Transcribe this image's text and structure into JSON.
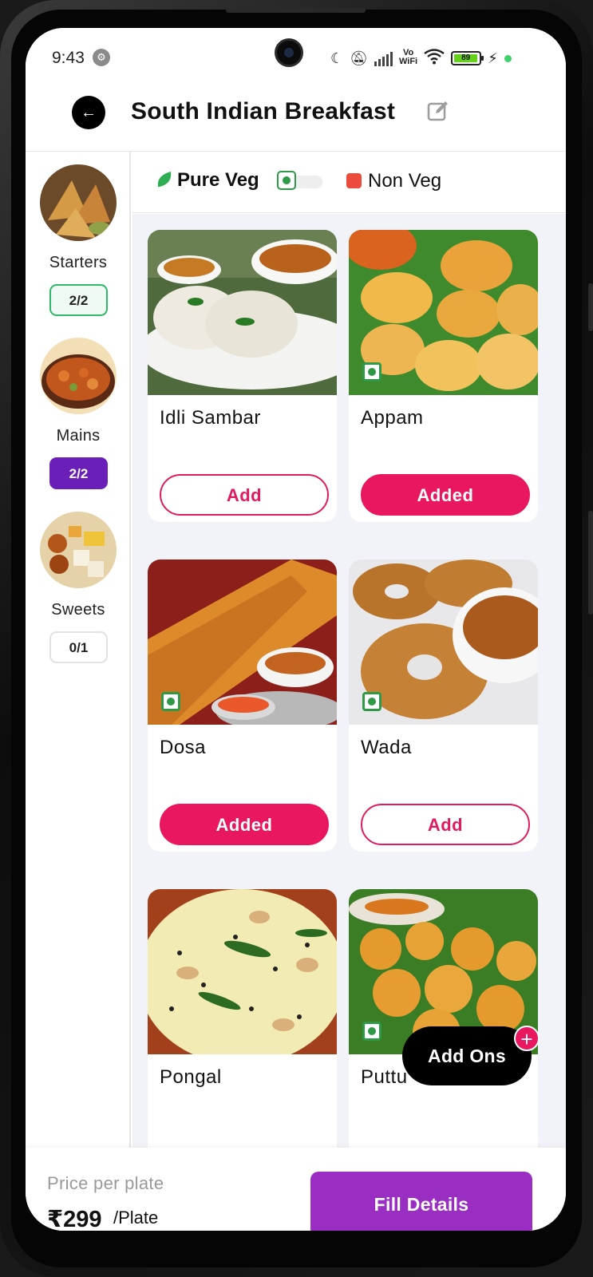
{
  "status_bar": {
    "time": "9:43",
    "vowifi_line1": "Vo",
    "vowifi_line2": "WiFi",
    "battery": "89"
  },
  "header": {
    "title": "South Indian Breakfast"
  },
  "sidebar": {
    "categories": [
      {
        "label": "Starters",
        "count": "2/2"
      },
      {
        "label": "Mains",
        "count": "2/2"
      },
      {
        "label": "Sweets",
        "count": "0/1"
      }
    ]
  },
  "filters": {
    "pure_veg_label": "Pure Veg",
    "non_veg_label": "Non Veg"
  },
  "items": [
    {
      "name": "Idli Sambar",
      "button": "Add"
    },
    {
      "name": "Appam",
      "button": "Added"
    },
    {
      "name": "Dosa",
      "button": "Added"
    },
    {
      "name": "Wada",
      "button": "Add"
    },
    {
      "name": "Pongal",
      "button": ""
    },
    {
      "name": "Puttu",
      "button": ""
    }
  ],
  "addons": {
    "label": "Add Ons",
    "plus": "+"
  },
  "footer": {
    "price_label": "Price per plate",
    "price_value": "₹299",
    "price_unit": "/Plate",
    "cta_label": "Fill Details"
  },
  "colors": {
    "accent_pink": "#e8175f",
    "accent_purple": "#9b2ec2",
    "mains_badge": "#6a1fb8",
    "veg_green": "#2e9a48",
    "nonveg_red": "#ec4a3a"
  }
}
